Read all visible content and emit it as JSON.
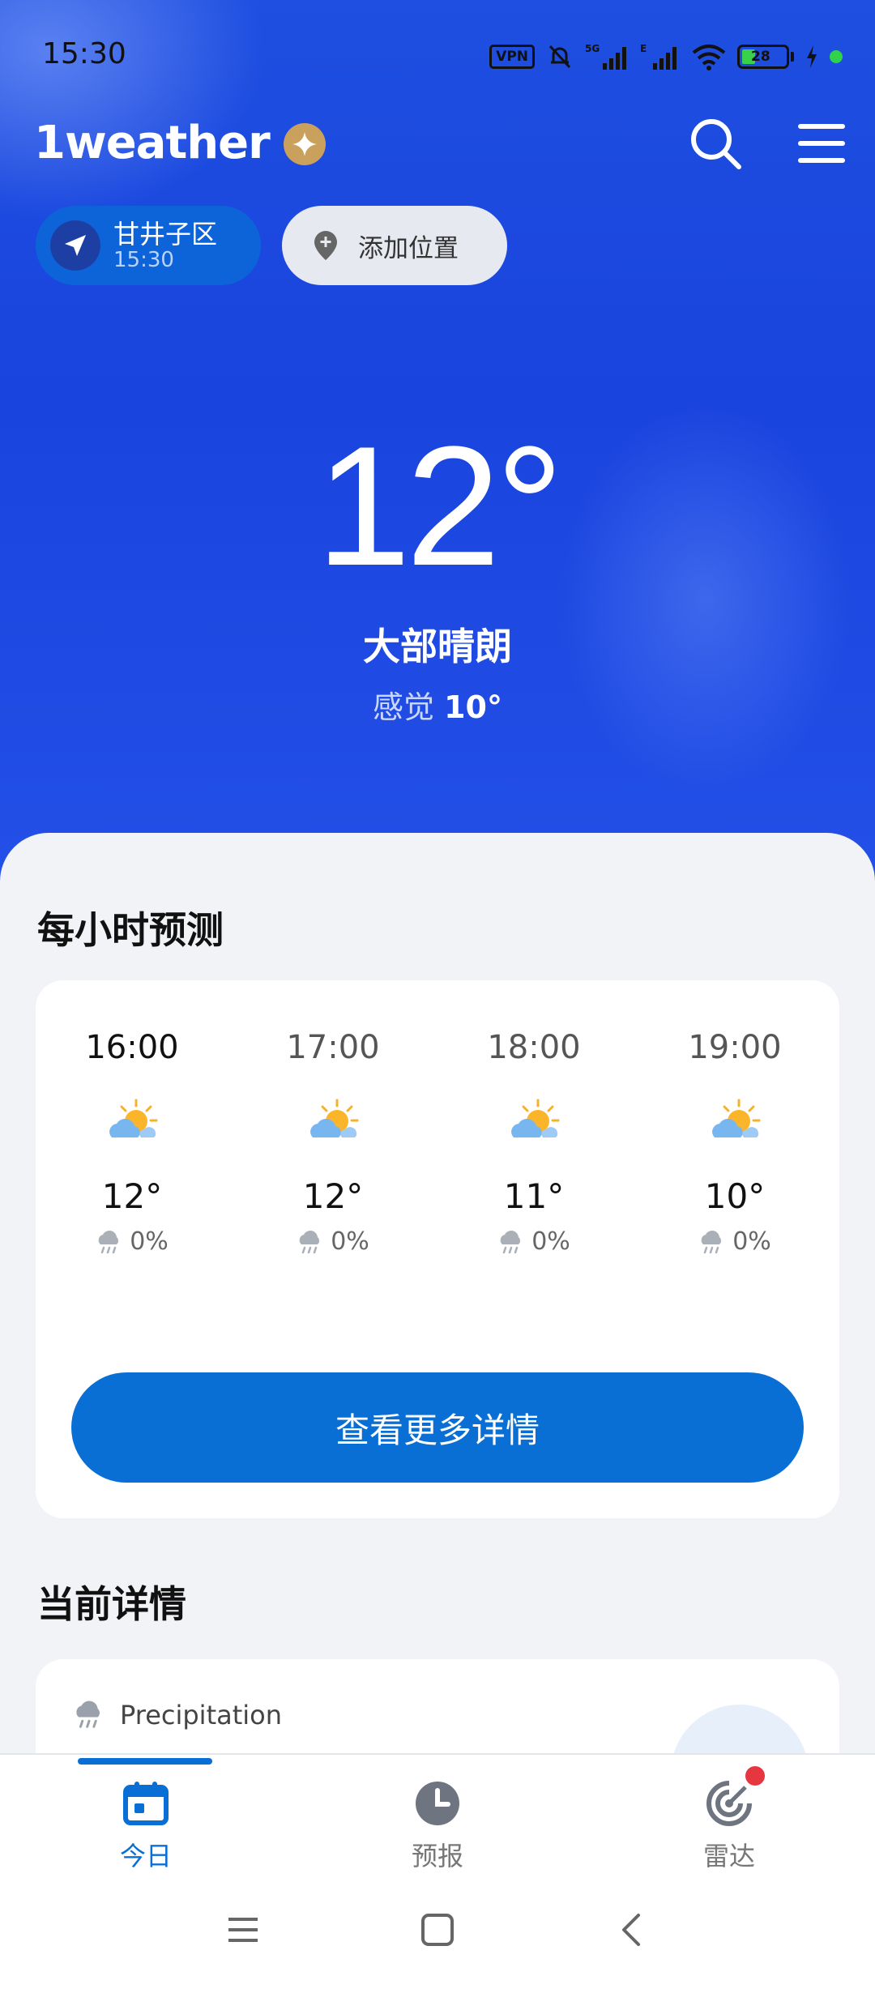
{
  "status_bar": {
    "time": "15:30",
    "vpn": "VPN",
    "network_1": "5G",
    "network_2": "E",
    "battery": "28"
  },
  "header": {
    "app_name": "1weather",
    "icons": [
      "premium-star-icon",
      "search-icon",
      "menu-icon"
    ]
  },
  "locations": {
    "current": {
      "name": "甘井子区",
      "time": "15:30"
    },
    "add_label": "添加位置"
  },
  "current": {
    "temperature": "12°",
    "condition": "大部晴朗",
    "feels_label": "感觉",
    "feels_value": "10°"
  },
  "hourly": {
    "title": "每小时预测",
    "items": [
      {
        "time": "16:00",
        "temp": "12°",
        "precip": "0%",
        "icon": "partly-sunny-icon"
      },
      {
        "time": "17:00",
        "temp": "12°",
        "precip": "0%",
        "icon": "partly-sunny-icon"
      },
      {
        "time": "18:00",
        "temp": "11°",
        "precip": "0%",
        "icon": "partly-sunny-icon"
      },
      {
        "time": "19:00",
        "temp": "10°",
        "precip": "0%",
        "icon": "partly-sunny-icon"
      }
    ],
    "more_button": "查看更多详情"
  },
  "current_details": {
    "title": "当前详情",
    "precipitation_label": "Precipitation"
  },
  "bottom_nav": {
    "items": [
      {
        "label": "今日",
        "icon": "calendar-icon",
        "active": true
      },
      {
        "label": "预报",
        "icon": "clock-icon",
        "active": false
      },
      {
        "label": "雷达",
        "icon": "radar-icon",
        "active": false
      }
    ]
  },
  "colors": {
    "hero_blue": "#1a44de",
    "accent": "#0a6fd4",
    "chip_active": "#0d64d8"
  }
}
